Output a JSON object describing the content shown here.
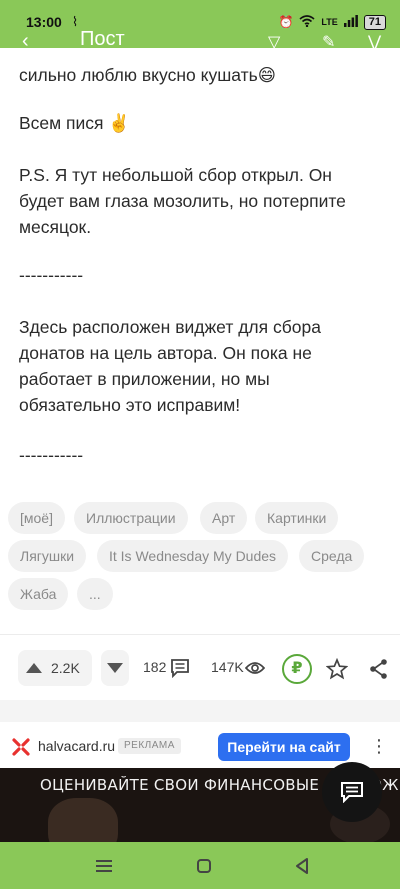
{
  "status_bar": {
    "time": "13:00",
    "battery": "71",
    "network": "LTE"
  },
  "header": {
    "title": "Пост"
  },
  "article": {
    "line1": "сильно люблю вкусно кушать😄",
    "line2": "Всем пися ✌️",
    "line3": "P.S. Я тут небольшой сбор открыл. Он будет вам глаза мозолить, но потерпите месяцок.",
    "separator1": "-----------",
    "line4": "Здесь расположен виджет для сбора донатов на цель автора. Он пока не работает в приложении, но мы обязательно это исправим!",
    "separator2": "-----------"
  },
  "tags": [
    "[моё]",
    "Иллюстрации",
    "Арт",
    "Картинки",
    "Лягушки",
    "It Is Wednesday My Dudes",
    "Среда",
    "Жаба",
    "..."
  ],
  "actions": {
    "rating": "2.2K",
    "comments": "182",
    "views": "147K",
    "donate_symbol": "₽"
  },
  "ad": {
    "domain": "halvacard.ru",
    "badge": "РЕКЛАМА",
    "button": "Перейти на сайт",
    "banner_text": "ОЦЕНИВАЙТЕ СВОИ ФИНАНСОВЫЕ ВОЗМОЖНОСТИ И"
  },
  "colors": {
    "brand_green": "#8ac858",
    "ad_button": "#2d6ff0",
    "donate_green": "#5aa83a",
    "ad_logo": "#e8312f"
  }
}
